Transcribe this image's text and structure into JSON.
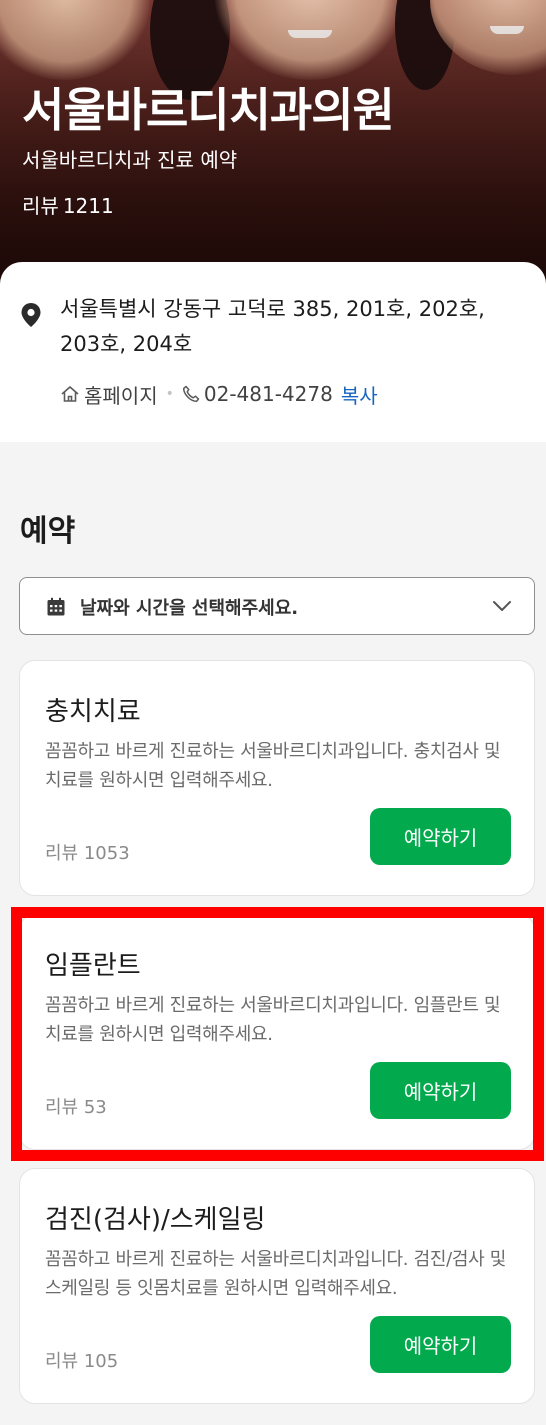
{
  "clinic": {
    "name": "서울바르디치과의원",
    "subtitle": "서울바르디치과 진료 예약",
    "review_label": "리뷰",
    "review_count": "1211"
  },
  "info": {
    "address": "서울특별시 강동구 고덕로 385, 201호, 202호, 203호, 204호",
    "homepage_label": "홈페이지",
    "phone": "02-481-4278",
    "copy_label": "복사"
  },
  "booking": {
    "section_title": "예약",
    "date_placeholder": "날짜와 시간을 선택해주세요.",
    "items": [
      {
        "name": "충치치료",
        "description": "꼼꼼하고 바르게 진료하는 서울바르디치과입니다. 충치검사 및 치료를 원하시면 입력해주세요.",
        "reviews": "리뷰 1053",
        "button": "예약하기"
      },
      {
        "name": "임플란트",
        "description": "꼼꼼하고 바르게 진료하는 서울바르디치과입니다. 임플란트 및 치료를 원하시면 입력해주세요.",
        "reviews": "리뷰 53",
        "button": "예약하기"
      },
      {
        "name": "검진(검사)/스케일링",
        "description": "꼼꼼하고 바르게 진료하는 서울바르디치과입니다. 검진/검사 및 스케일링 등 잇몸치료를 원하시면 입력해주세요.",
        "reviews": "리뷰 105",
        "button": "예약하기"
      }
    ]
  },
  "colors": {
    "accent_green": "#03a94d",
    "link_blue": "#1665c0",
    "highlight_red": "#ff0000",
    "hero_dark": "#3c1612"
  }
}
